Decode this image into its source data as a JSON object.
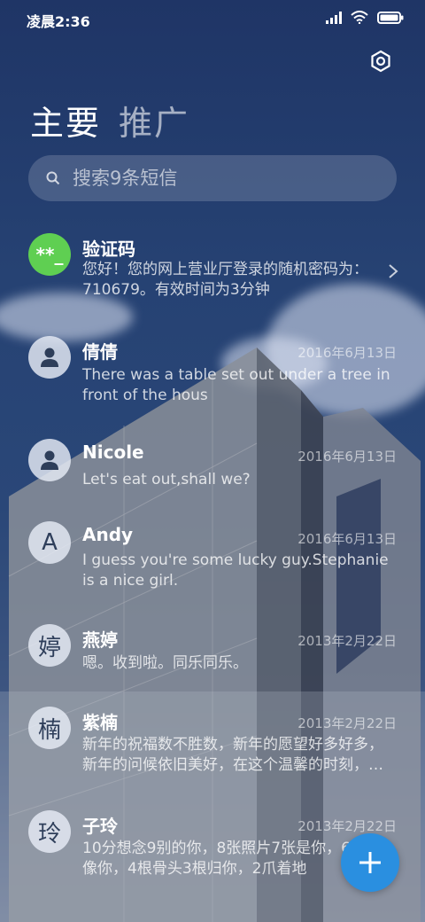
{
  "status_bar": {
    "time": "凌晨2:36"
  },
  "header": {
    "tabs": [
      {
        "label": "主要",
        "active": true
      },
      {
        "label": "推广",
        "active": false
      }
    ]
  },
  "search": {
    "placeholder": "搜索9条短信",
    "value": ""
  },
  "threads": [
    {
      "avatar": "**_",
      "name": "验证码",
      "date": "",
      "preview": "您好！您的网上营业厅登录的随机密码为：710679。有效时间为3分钟",
      "avatar_color": "#5fcf52"
    },
    {
      "avatar": "person-icon",
      "name": "倩倩",
      "date": "2016年6月13日",
      "preview": "There was a table set out under a tree in front of the hous"
    },
    {
      "avatar": "person-icon",
      "name": "Nicole",
      "date": "2016年6月13日",
      "preview": "Let's eat out,shall we?"
    },
    {
      "avatar": "A",
      "name": "Andy",
      "date": "2016年6月13日",
      "preview": "I guess you're some lucky guy.Stephanie is a nice girl."
    },
    {
      "avatar": "婷",
      "name": "燕婷",
      "date": "2013年2月22日",
      "preview": "嗯。收到啦。同乐同乐。"
    },
    {
      "avatar": "楠",
      "name": "紫楠",
      "date": "2013年2月22日",
      "preview": "新年的祝福数不胜数，新年的愿望好多好多，新年的问候依旧美好，在这个温馨的时刻，…"
    },
    {
      "avatar": "玲",
      "name": "子玲",
      "date": "2013年2月22日",
      "preview": "10分想念9别的你，8张照片7张是你，6狗5只像你，4根骨头3根归你，2爪着地"
    }
  ],
  "colors": {
    "fab": "#2a8fe0",
    "verify_avatar": "#5fcf52"
  }
}
